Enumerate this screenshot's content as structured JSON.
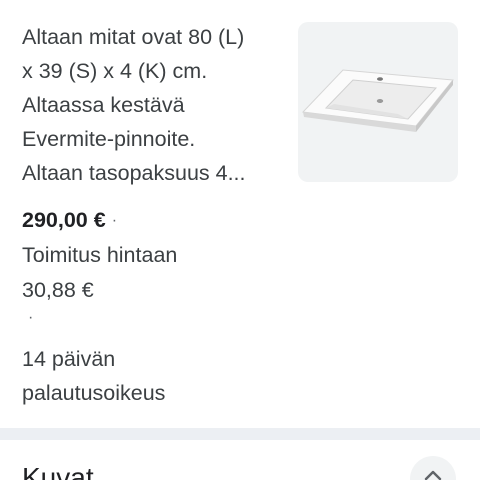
{
  "product": {
    "description_lines": [
      "Altaan mitat ovat 80 (L)",
      "x 39 (S) x 4 (K) cm.",
      "Altaassa kestävä",
      "Evermite-pinnoite.",
      "Altaan tasopaksuus 4..."
    ],
    "price": "290,00 €",
    "separator": "·",
    "shipping_lines": [
      "Toimitus hintaan",
      "30,88 €"
    ],
    "returns_lines": [
      "14 päivän",
      "palautusoikeus"
    ],
    "image_icon": "sink-product-image"
  },
  "section": {
    "title": "Kuvat",
    "toggle_icon": "chevron-up-icon"
  },
  "colors": {
    "text": "#3c4043",
    "price": "#202124",
    "thumb_bg": "#f1f3f4",
    "divider": "#eceff3"
  }
}
